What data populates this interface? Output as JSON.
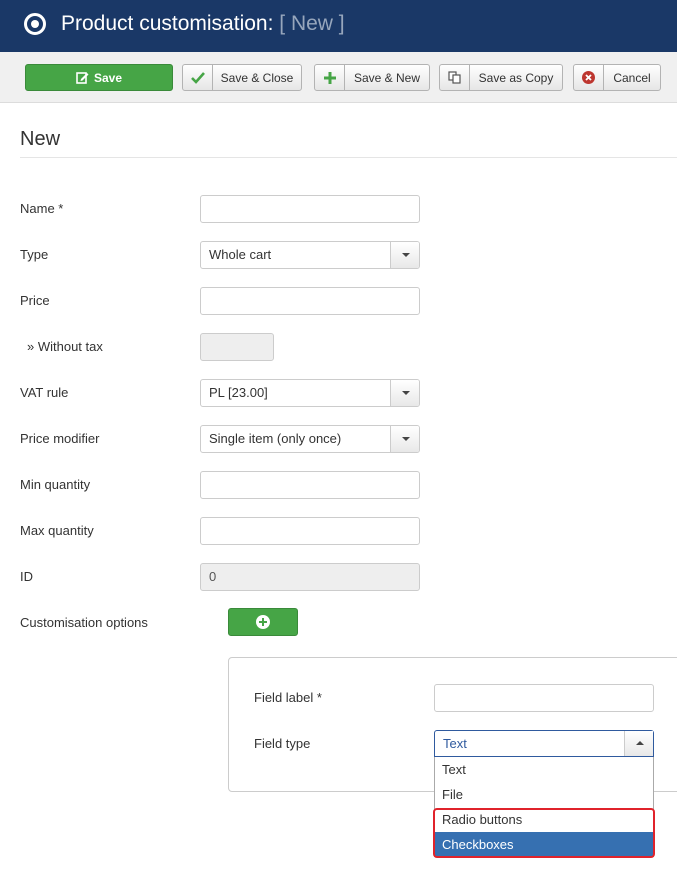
{
  "header": {
    "title": "Product customisation:",
    "subtitle": "[ New ]"
  },
  "toolbar": {
    "save": "Save",
    "save_close": "Save & Close",
    "save_new": "Save & New",
    "save_copy": "Save as Copy",
    "cancel": "Cancel"
  },
  "page": {
    "heading": "New"
  },
  "form": {
    "name": {
      "label": "Name *",
      "value": ""
    },
    "type": {
      "label": "Type",
      "value": "Whole cart"
    },
    "price": {
      "label": "Price",
      "value": ""
    },
    "without_tax": {
      "label": "» Without tax",
      "value": ""
    },
    "vat_rule": {
      "label": "VAT rule",
      "value": "PL [23.00]"
    },
    "price_modifier": {
      "label": "Price modifier",
      "value": "Single item (only once)"
    },
    "min_quantity": {
      "label": "Min quantity",
      "value": ""
    },
    "max_quantity": {
      "label": "Max quantity",
      "value": ""
    },
    "id": {
      "label": "ID",
      "value": "0"
    },
    "customisation_options": {
      "label": "Customisation options"
    }
  },
  "option_panel": {
    "field_label": {
      "label": "Field label *",
      "value": ""
    },
    "field_type": {
      "label": "Field type",
      "selected": "Text",
      "options": [
        "Text",
        "File",
        "Radio buttons",
        "Checkboxes"
      ],
      "highlighted": "Checkboxes"
    }
  },
  "colors": {
    "header_bg": "#1a3867",
    "save_green": "#46a546",
    "highlight_blue": "#3670b1",
    "annotation_red": "#e0232b"
  }
}
